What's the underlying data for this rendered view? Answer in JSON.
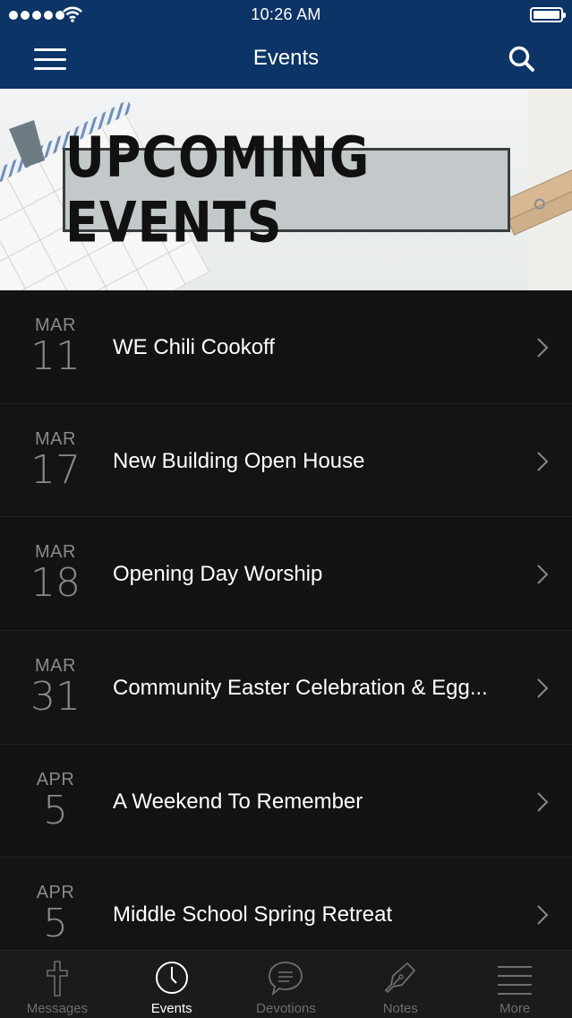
{
  "status_bar": {
    "time": "10:26 AM"
  },
  "nav": {
    "title": "Events",
    "menu_icon": "hamburger-icon",
    "search_icon": "search-icon"
  },
  "banner": {
    "text": "UPCOMING EVENTS"
  },
  "events": [
    {
      "month": "MAR",
      "day": "11",
      "title": "WE Chili Cookoff"
    },
    {
      "month": "MAR",
      "day": "17",
      "title": "New Building Open House"
    },
    {
      "month": "MAR",
      "day": "18",
      "title": "Opening Day Worship"
    },
    {
      "month": "MAR",
      "day": "31",
      "title": "Community Easter Celebration & Egg..."
    },
    {
      "month": "APR",
      "day": "5",
      "title": "A Weekend To Remember"
    },
    {
      "month": "APR",
      "day": "5",
      "title": "Middle School Spring Retreat"
    }
  ],
  "tabs": [
    {
      "label": "Messages",
      "icon": "cross-icon",
      "active": false
    },
    {
      "label": "Events",
      "icon": "clock-icon",
      "active": true
    },
    {
      "label": "Devotions",
      "icon": "speech-bubble-icon",
      "active": false
    },
    {
      "label": "Notes",
      "icon": "pen-icon",
      "active": false
    },
    {
      "label": "More",
      "icon": "list-icon",
      "active": false
    }
  ],
  "colors": {
    "header": "#0c3466",
    "background": "#131314",
    "tab_bar": "#1b1b1c",
    "muted_text": "#8a8a8e"
  }
}
